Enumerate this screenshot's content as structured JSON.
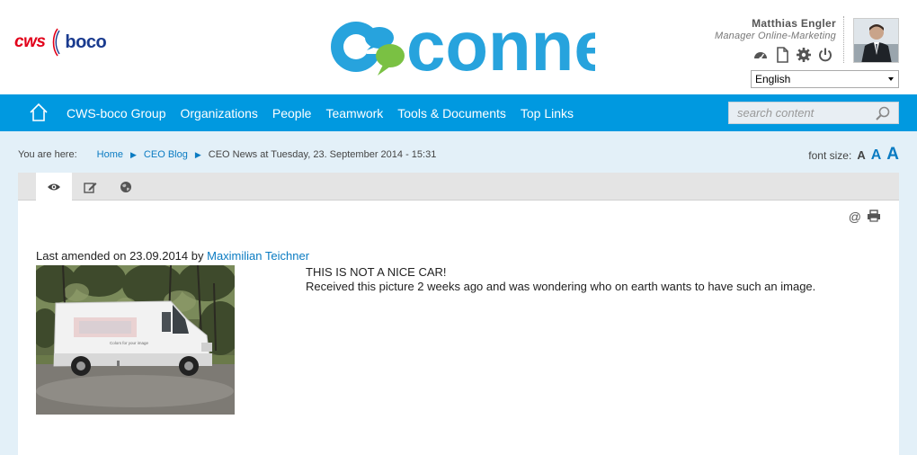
{
  "header": {
    "brand_left": {
      "cws": "cws",
      "boco": "boco"
    },
    "brand_center": "connect",
    "user": {
      "name": "Matthias Engler",
      "role": "Manager Online-Marketing",
      "icons": [
        "dashboard-icon",
        "document-icon",
        "gear-icon",
        "power-icon"
      ]
    },
    "language": {
      "selected": "English"
    }
  },
  "nav": {
    "items": [
      "CWS-boco Group",
      "Organizations",
      "People",
      "Teamwork",
      "Tools & Documents",
      "Top Links"
    ],
    "search_placeholder": "search content"
  },
  "breadcrumb": {
    "prefix": "You are here:",
    "items": [
      "Home",
      "CEO Blog",
      "CEO News at Tuesday, 23. September 2014 - 15:31"
    ]
  },
  "font_size": {
    "label": "font size:",
    "small": "A",
    "medium": "A",
    "large": "A"
  },
  "tabs": [
    "view-icon",
    "edit-icon",
    "globe-icon"
  ],
  "tools": {
    "email": "@",
    "print": "print-icon"
  },
  "article": {
    "amended_prefix": "Last amended on 23.09.2014 by",
    "author": "Maximilian Teichner",
    "line1": "THIS IS NOT A NICE CAR!",
    "line2": "Received this picture 2 weeks ago and was wondering who on earth wants to have such an image.",
    "van_text": "Colors for your image"
  },
  "colors": {
    "nav_blue": "#0099e0",
    "link_blue": "#0a7bc2",
    "content_bg": "#e3f0f8",
    "cws_red": "#e2001a",
    "boco_navy": "#1a3b8f"
  }
}
